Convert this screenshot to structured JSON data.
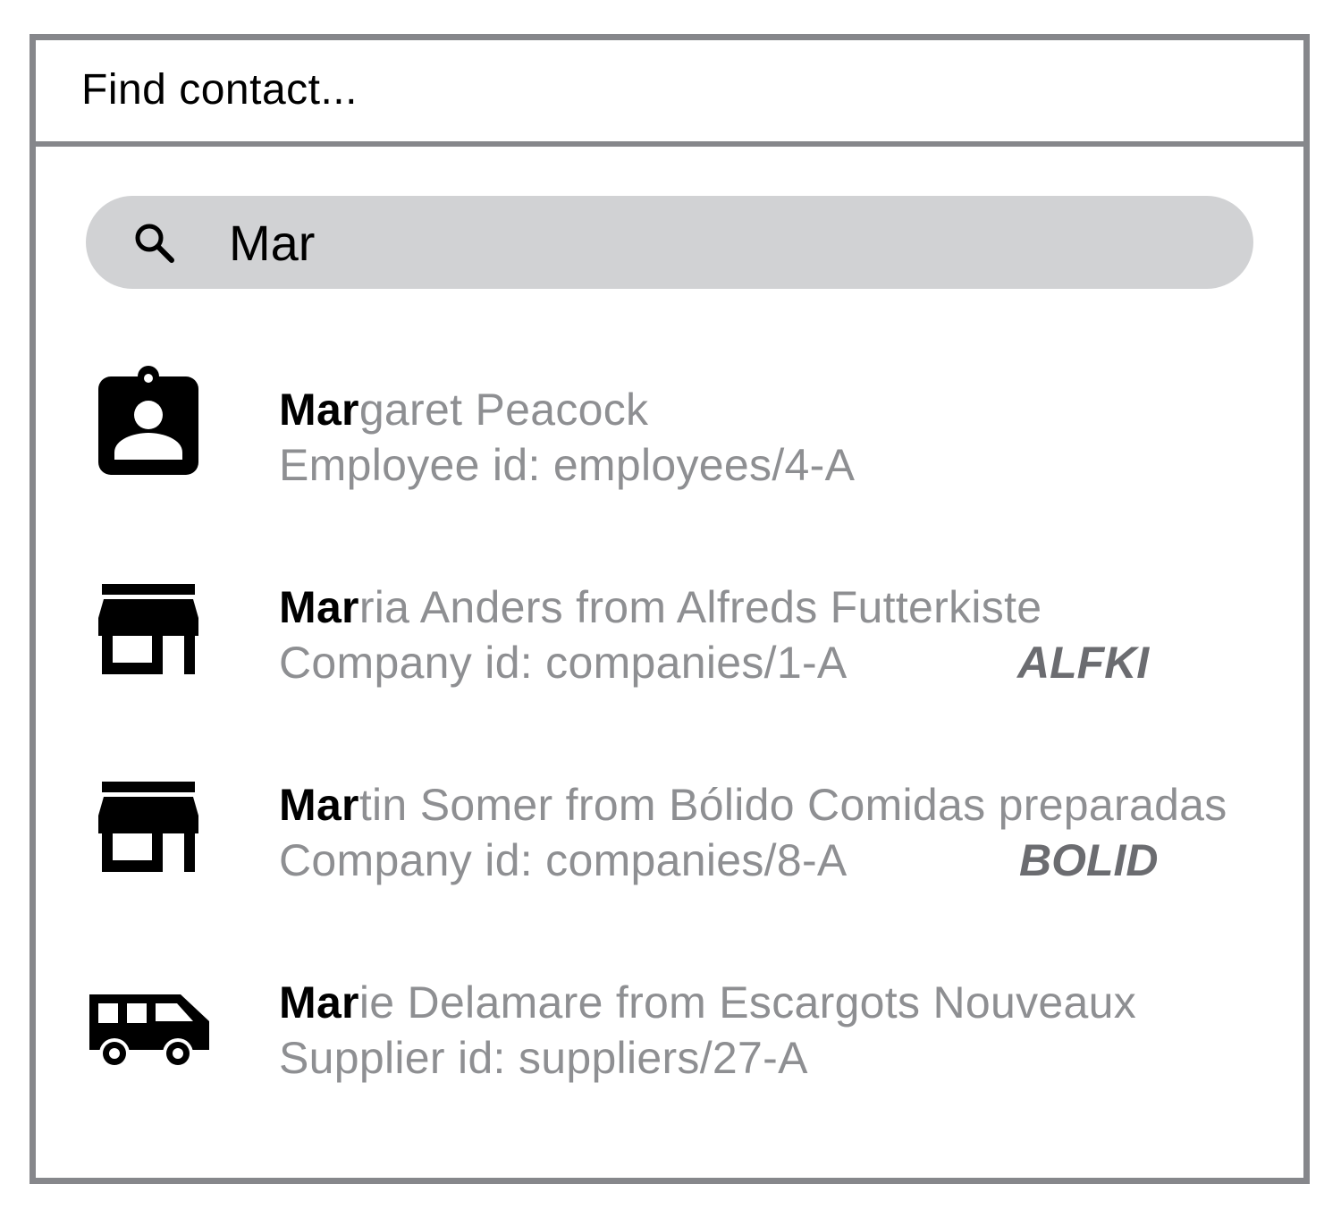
{
  "dialog": {
    "title": "Find contact..."
  },
  "search": {
    "value": "Mar",
    "icon": "search-icon"
  },
  "results": [
    {
      "type": "employee",
      "icon": "employee-badge-icon",
      "name_match": "Mar",
      "name_rest": "garet Peacock",
      "id_text": "Employee id: employees/4-A",
      "code": ""
    },
    {
      "type": "company",
      "icon": "storefront-icon",
      "name_match": "Mar",
      "name_rest": "ria Anders from Alfreds Futterkiste",
      "id_text": "Company id: companies/1-A",
      "code": "ALFKI"
    },
    {
      "type": "company",
      "icon": "storefront-icon",
      "name_match": "Mar",
      "name_rest": "tin Somer from Bólido Comidas preparadas",
      "id_text": "Company id: companies/8-A",
      "code": "BOLID"
    },
    {
      "type": "supplier",
      "icon": "van-icon",
      "name_match": "Mar",
      "name_rest": "ie Delamare from Escargots Nouveaux",
      "id_text": "Supplier id: suppliers/27-A",
      "code": ""
    }
  ],
  "colors": {
    "border": "#86878b",
    "search_bg": "#d1d2d4",
    "secondary_text": "#8e8f92",
    "code_text": "#6b6c70",
    "match_text": "#000000"
  }
}
